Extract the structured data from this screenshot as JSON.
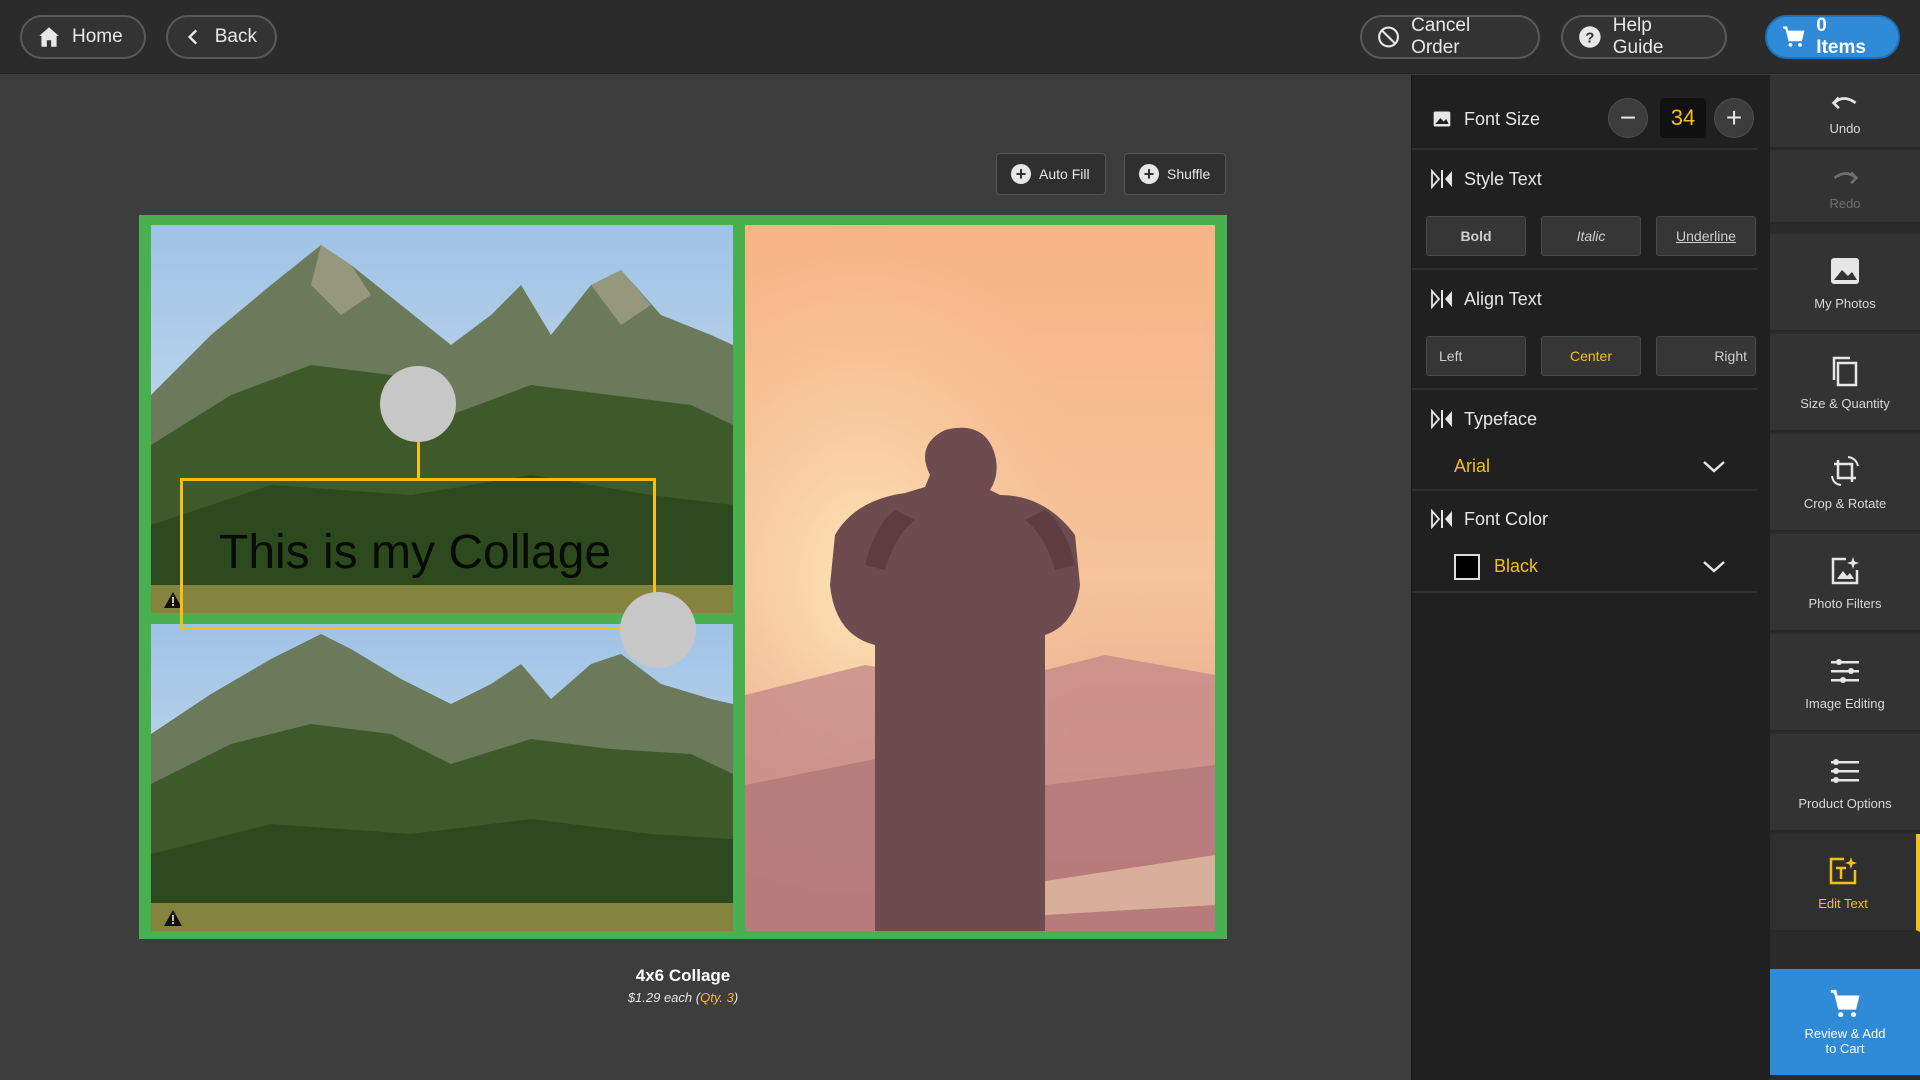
{
  "topbar": {
    "home_label": "Home",
    "back_label": "Back",
    "cancel_label": "Cancel Order",
    "help_label": "Help Guide",
    "cart_label": "0 Items"
  },
  "canvas": {
    "auto_fill_label": "Auto Fill",
    "shuffle_label": "Shuffle",
    "collage_text": "This is my Collage",
    "product_title": "4x6 Collage",
    "price_text": "$1.29 each",
    "qty_open": " (",
    "qty_text": "Qty. 3",
    "qty_close": ")"
  },
  "panel": {
    "font_size_label": "Font Size",
    "font_size_value": "34",
    "style_text_label": "Style Text",
    "bold_label": "Bold",
    "italic_label": "Italic",
    "underline_label": "Underline",
    "align_text_label": "Align Text",
    "left_label": "Left",
    "center_label": "Center",
    "right_label": "Right",
    "active_align": "Center",
    "typeface_label": "Typeface",
    "typeface_value": "Arial",
    "font_color_label": "Font Color",
    "font_color_value": "Black"
  },
  "toolbar": {
    "undo": "Undo",
    "redo": "Redo",
    "my_photos": "My Photos",
    "size_quantity": "Size & Quantity",
    "crop_rotate": "Crop & Rotate",
    "photo_filters": "Photo Filters",
    "image_editing": "Image Editing",
    "product_options": "Product Options",
    "edit_text": "Edit Text",
    "review_cart": "Review & Add to Cart",
    "active_tool": "Edit Text"
  },
  "colors": {
    "accent": "#f5bf18",
    "primary": "#2f8bd8",
    "collage_border": "#49b04f"
  }
}
